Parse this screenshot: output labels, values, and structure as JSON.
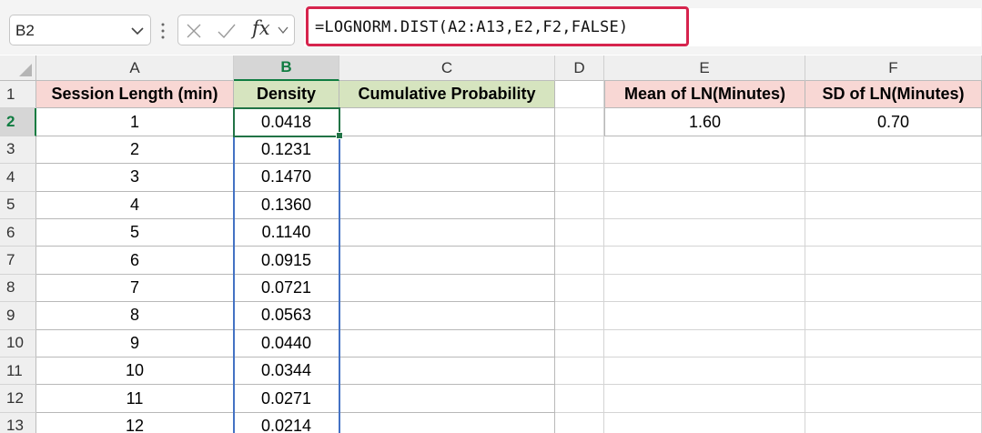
{
  "formula_bar": {
    "name_box": "B2",
    "fx_label": "fx",
    "formula": "=LOGNORM.DIST(A2:A13,E2,F2,FALSE)"
  },
  "colors": {
    "header_pink": "#f8d7d4",
    "header_green": "#d6e4bf",
    "formula_highlight": "#d6244d",
    "active_green": "#217346",
    "range_blue": "#4472c4"
  },
  "sheet": {
    "columns": [
      "A",
      "B",
      "C",
      "D",
      "E",
      "F"
    ],
    "rows": [
      "1",
      "2",
      "3",
      "4",
      "5",
      "6",
      "7",
      "8",
      "9",
      "10",
      "11",
      "12",
      "13"
    ],
    "headers": {
      "a": "Session Length (min)",
      "b": "Density",
      "c": "Cumulative Probability",
      "e": "Mean of LN(Minutes)",
      "f": "SD of LN(Minutes)"
    },
    "params": {
      "mean": "1.60",
      "sd": "0.70"
    },
    "data": [
      {
        "length": "1",
        "density": "0.0418"
      },
      {
        "length": "2",
        "density": "0.1231"
      },
      {
        "length": "3",
        "density": "0.1470"
      },
      {
        "length": "4",
        "density": "0.1360"
      },
      {
        "length": "5",
        "density": "0.1140"
      },
      {
        "length": "6",
        "density": "0.0915"
      },
      {
        "length": "7",
        "density": "0.0721"
      },
      {
        "length": "8",
        "density": "0.0563"
      },
      {
        "length": "9",
        "density": "0.0440"
      },
      {
        "length": "10",
        "density": "0.0344"
      },
      {
        "length": "11",
        "density": "0.0271"
      },
      {
        "length": "12",
        "density": "0.0214"
      }
    ]
  }
}
